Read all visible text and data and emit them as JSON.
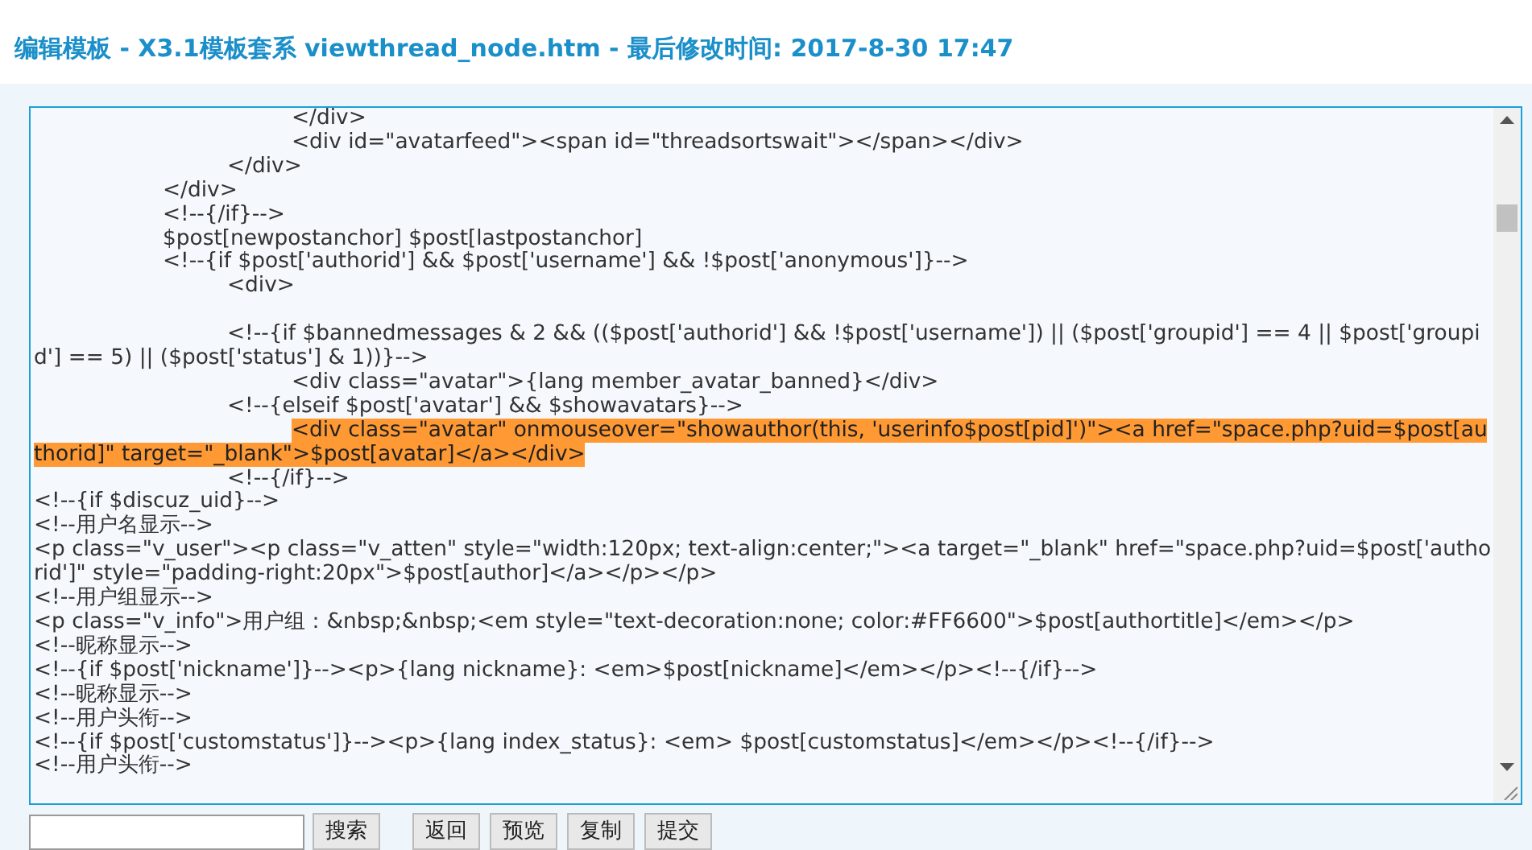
{
  "title": "编辑模板 - X3.1模板套系 viewthread_node.htm - 最后修改时间: 2017-8-30 17:47",
  "editor": {
    "lines": [
      {
        "text": "\t\t\t\t</div>",
        "selected": false
      },
      {
        "text": "\t\t\t\t<div id=\"avatarfeed\"><span id=\"threadsortswait\"></span></div>",
        "selected": false
      },
      {
        "text": "\t\t\t</div>",
        "selected": false
      },
      {
        "text": "\t\t</div>",
        "selected": false
      },
      {
        "text": "\t\t<!--{/if}-->",
        "selected": false
      },
      {
        "text": "\t\t$post[newpostanchor] $post[lastpostanchor]",
        "selected": false
      },
      {
        "text": "\t\t<!--{if $post['authorid'] && $post['username'] && !$post['anonymous']}-->",
        "selected": false
      },
      {
        "text": "\t\t\t<div>",
        "selected": false
      },
      {
        "selected": false
      },
      {
        "text": "\t\t\t<!--{if $bannedmessages & 2 && (($post['authorid'] && !$post['username']) || ($post['groupid'] == 4 || $post['groupid'] == 5) || ($post['status'] & 1))}-->",
        "selected": false
      },
      {
        "text": "\t\t\t\t<div class=\"avatar\">{lang member_avatar_banned}</div>",
        "selected": false
      },
      {
        "text": "\t\t\t<!--{elseif $post['avatar'] && $showavatars}-->",
        "selected": false
      },
      {
        "text": "\t\t\t\t<div class=\"avatar\" onmouseover=\"showauthor(this, 'userinfo$post[pid]')\"><a href=\"space.php?uid=$post[authorid]\" target=\"_blank\">$post[avatar]</a></div>",
        "selected": true
      },
      {
        "text": "\t\t\t<!--{/if}-->",
        "selected": false
      },
      {
        "text": "<!--{if $discuz_uid}-->",
        "selected": false
      },
      {
        "text": "<!--用户名显示-->",
        "selected": false
      },
      {
        "text": "<p class=\"v_user\"><p class=\"v_atten\" style=\"width:120px; text-align:center;\"><a target=\"_blank\" href=\"space.php?uid=$post['authorid']\" style=\"padding-right:20px\">$post[author]</a></p></p>",
        "selected": false
      },
      {
        "text": "<!--用户组显示-->",
        "selected": false
      },
      {
        "text": "<p class=\"v_info\">用户组：&nbsp;&nbsp;<em style=\"text-decoration:none; color:#FF6600\">$post[authortitle]</em></p>",
        "selected": false
      },
      {
        "text": "<!--昵称显示-->",
        "selected": false
      },
      {
        "text": "<!--{if $post['nickname']}--><p>{lang nickname}: <em>$post[nickname]</em></p><!--{/if}-->",
        "selected": false
      },
      {
        "text": "<!--昵称显示-->",
        "selected": false
      },
      {
        "text": "<!--用户头衔-->",
        "selected": false
      },
      {
        "text": "<!--{if $post['customstatus']}--><p>{lang index_status}: <em> $post[customstatus]</em></p><!--{/if}-->",
        "selected": false
      },
      {
        "text": "<!--用户头衔-->",
        "selected": false
      }
    ]
  },
  "buttons": [
    "搜索",
    "返回",
    "预览",
    "复制",
    "提交"
  ]
}
